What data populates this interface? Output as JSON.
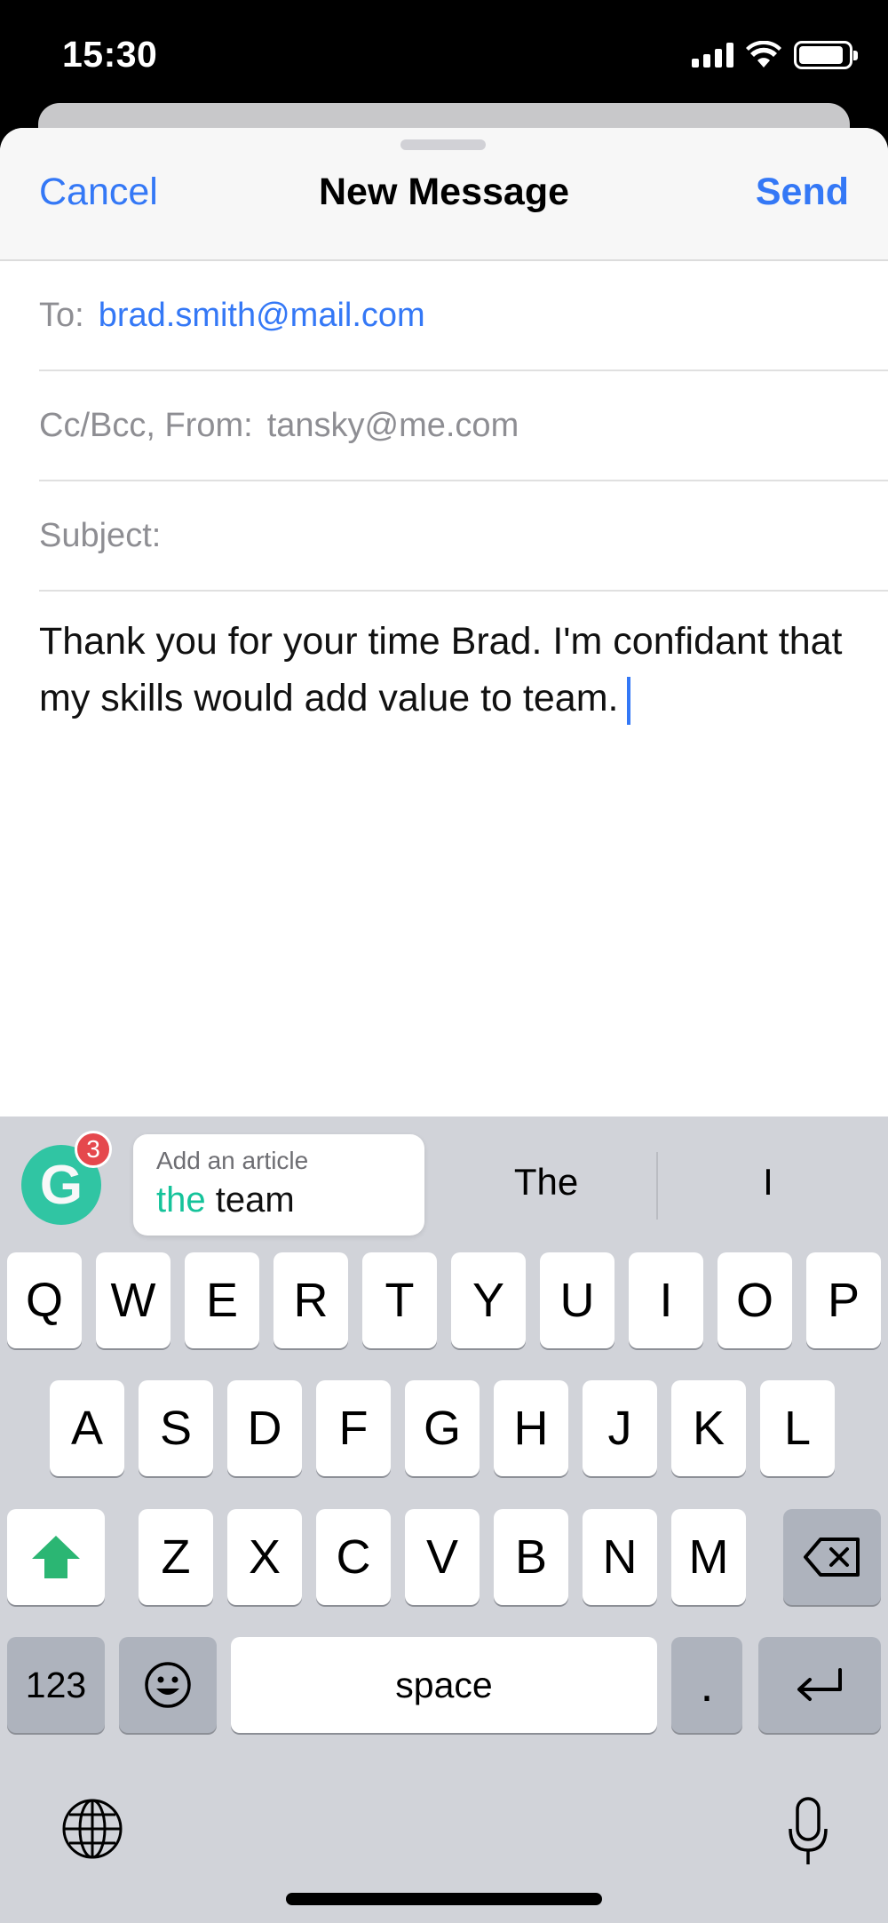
{
  "status_bar": {
    "time": "15:30"
  },
  "compose": {
    "cancel_label": "Cancel",
    "title": "New Message",
    "send_label": "Send",
    "to_label": "To:",
    "to_value": "brad.smith@mail.com",
    "cc_label": "Cc/Bcc, From:",
    "cc_value": "tansky@me.com",
    "subject_label": "Subject:",
    "subject_value": "",
    "body": "Thank you for your time Brad. I'm confidant that my skills would add value to team."
  },
  "grammarly": {
    "badge_count": "3",
    "logo_letter": "G",
    "card_title": "Add an article",
    "card_added_word": "the",
    "card_word": "team"
  },
  "predictions": [
    "The",
    "I"
  ],
  "keyboard": {
    "row1": [
      "Q",
      "W",
      "E",
      "R",
      "T",
      "Y",
      "U",
      "I",
      "O",
      "P"
    ],
    "row2": [
      "A",
      "S",
      "D",
      "F",
      "G",
      "H",
      "J",
      "K",
      "L"
    ],
    "row3": [
      "Z",
      "X",
      "C",
      "V",
      "B",
      "N",
      "M"
    ],
    "numbers_label": "123",
    "space_label": "space",
    "period_label": "."
  },
  "colors": {
    "accent": "#3478f6",
    "grammarly_green": "#15c39a",
    "badge_red": "#e5484d",
    "keyboard_bg": "#d1d3d9"
  }
}
